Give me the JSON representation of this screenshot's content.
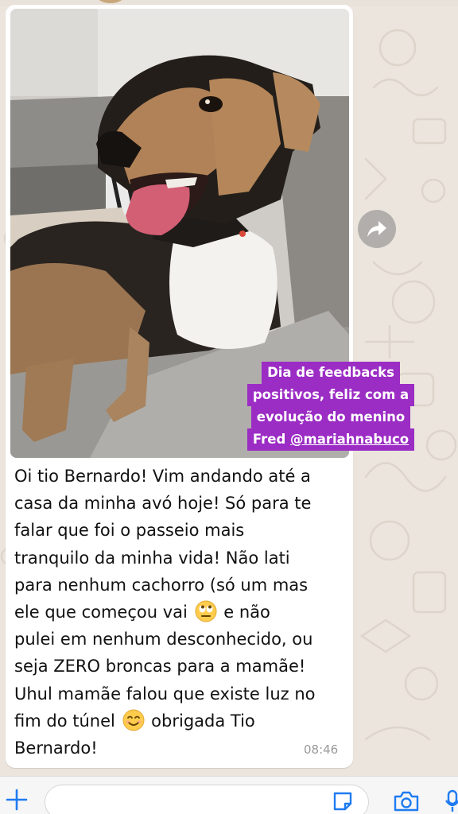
{
  "chat": {
    "message": {
      "photo_caption": {
        "line1": "Dia de feedbacks",
        "line2": "positivos, feliz com a",
        "line3": "evolução do menino",
        "line4_prefix": "Fred ",
        "line4_handle": "@mariahnabuco"
      },
      "text_lines": [
        "Oi tio Bernardo! Vim andando até a",
        "casa da minha avó hoje! Só para te",
        "falar que foi o passeio mais",
        "tranquilo da minha vida! Não lati",
        "para nenhum cachorro (só um mas"
      ],
      "line6_before_emoji": "ele que começou vai ",
      "line6_after_emoji": " e não",
      "text_lines_2": [
        "pulei em nenhum desconhecido, ou",
        "seja ZERO broncas para a mamãe!",
        "Uhul mamãe falou que existe luz no"
      ],
      "line10_before_emoji": "fim do túnel ",
      "line10_after_emoji": " obrigada Tio",
      "line11": "Bernardo!",
      "time": "08:46",
      "emojis": [
        "eye-roll-emoji",
        "smiling-emoji"
      ]
    }
  },
  "input_bar": {
    "icons": [
      "plus-icon",
      "sticker-icon",
      "camera-icon",
      "mic-icon"
    ],
    "placeholder": ""
  },
  "colors": {
    "caption_bg": "#9b2cc4",
    "bubble_bg": "#ffffff",
    "wallpaper": "#ece5dd"
  }
}
